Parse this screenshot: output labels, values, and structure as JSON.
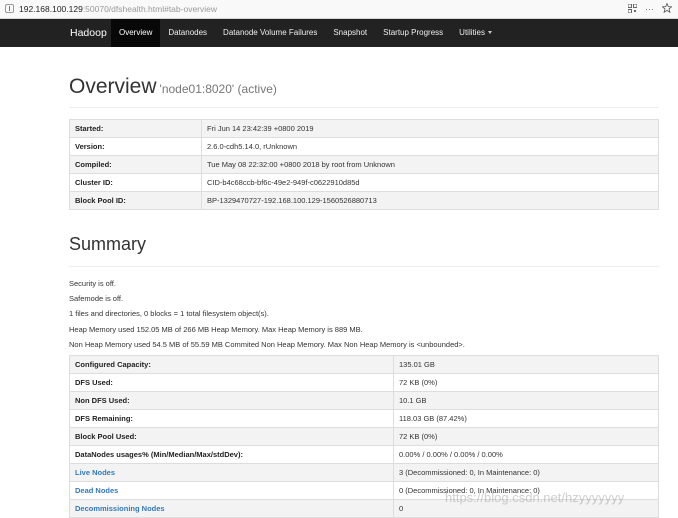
{
  "browser": {
    "url_host": "192.168.100.129",
    "url_rest": ":50070/dfshealth.html#tab-overview",
    "more_label": "···"
  },
  "navbar": {
    "brand": "Hadoop",
    "items": [
      {
        "label": "Overview",
        "active": true
      },
      {
        "label": "Datanodes"
      },
      {
        "label": "Datanode Volume Failures"
      },
      {
        "label": "Snapshot"
      },
      {
        "label": "Startup Progress"
      },
      {
        "label": "Utilities"
      }
    ]
  },
  "overview": {
    "title": "Overview",
    "subtitle": "'node01:8020' (active)",
    "rows": [
      {
        "key": "Started:",
        "value": "Fri Jun 14 23:42:39 +0800 2019"
      },
      {
        "key": "Version:",
        "value": "2.6.0-cdh5.14.0, rUnknown"
      },
      {
        "key": "Compiled:",
        "value": "Tue May 08 22:32:00 +0800 2018 by root from Unknown"
      },
      {
        "key": "Cluster ID:",
        "value": "CID-b4c68ccb-bf6c-49e2-949f-c0622910d85d"
      },
      {
        "key": "Block Pool ID:",
        "value": "BP-1329470727-192.168.100.129-1560526880713"
      }
    ]
  },
  "summary": {
    "title": "Summary",
    "lines": [
      "Security is off.",
      "Safemode is off.",
      "1 files and directories, 0 blocks = 1 total filesystem object(s).",
      "Heap Memory used 152.05 MB of 266 MB Heap Memory. Max Heap Memory is 889 MB.",
      "Non Heap Memory used 54.5 MB of 55.59 MB Commited Non Heap Memory. Max Non Heap Memory is <unbounded>."
    ],
    "rows": [
      {
        "key": "Configured Capacity:",
        "value": "135.01 GB"
      },
      {
        "key": "DFS Used:",
        "value": "72 KB (0%)"
      },
      {
        "key": "Non DFS Used:",
        "value": "10.1 GB"
      },
      {
        "key": "DFS Remaining:",
        "value": "118.03 GB (87.42%)"
      },
      {
        "key": "Block Pool Used:",
        "value": "72 KB (0%)"
      },
      {
        "key": "DataNodes usages% (Min/Median/Max/stdDev):",
        "value": "0.00% / 0.00% / 0.00% / 0.00%"
      },
      {
        "key": "Live Nodes",
        "value": "3 (Decommissioned: 0, In Maintenance: 0)"
      },
      {
        "key": "Dead Nodes",
        "value": "0 (Decommissioned: 0, In Maintenance: 0)"
      },
      {
        "key": "Decommissioning Nodes",
        "value": "0"
      }
    ]
  },
  "watermark": "https://blog.csdn.net/hzyyyyyyy"
}
